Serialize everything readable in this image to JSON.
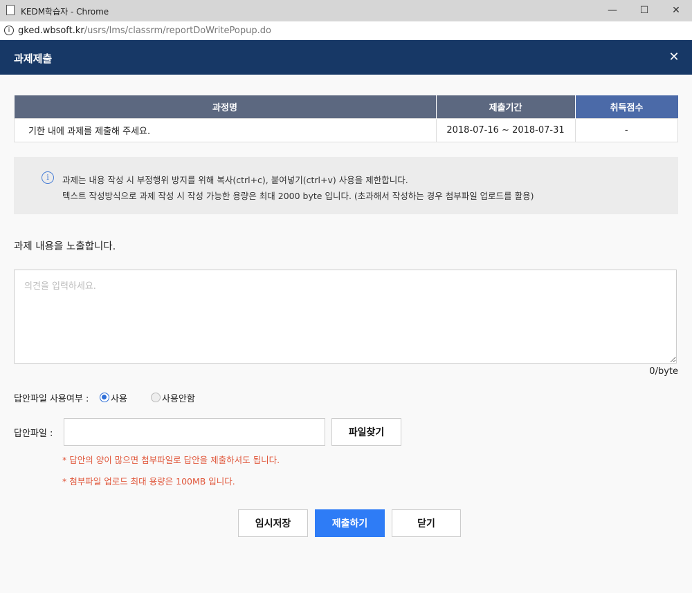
{
  "browser": {
    "window_title": "KEDM학습자 - Chrome",
    "url_host": "gked.wbsoft.kr",
    "url_path": "/usrs/lms/classrm/reportDoWritePopup.do"
  },
  "header": {
    "title": "과제제출"
  },
  "info_table": {
    "columns": [
      "과정명",
      "제출기간",
      "취득점수"
    ],
    "row": [
      "기한 내에 과제를 제출해 주세요.",
      "2018-07-16 ~ 2018-07-31",
      "-"
    ]
  },
  "notice": {
    "line1": "과제는 내용 작성 시 부정행위 방지를 위해 복사(ctrl+c), 붙여넣기(ctrl+v) 사용을 제한합니다.",
    "line2": "텍스트 작성방식으로 과제 작성 시 작성 가능한 용량은 최대 2000 byte 입니다. (초과해서 작성하는 경우 첨부파일 업로드를 활용)"
  },
  "content": {
    "subtitle": "과제 내용을 노출합니다.",
    "textarea_placeholder": "의견을 입력하세요.",
    "byte_count": "0/byte"
  },
  "answer_file": {
    "use_label": "답안파일 사용여부 :",
    "option_use": "사용",
    "option_not_use": "사용안함",
    "selected": "사용",
    "file_label": "답안파일 :",
    "find_button": "파일찾기",
    "note1": "* 답안의 양이 많으면 첨부파일로 답안을 제출하셔도 됩니다.",
    "note2": "* 첨부파일 업로드 최대 용량은 100MB 입니다."
  },
  "actions": {
    "temp_save": "임시저장",
    "submit": "제출하기",
    "close": "닫기"
  }
}
